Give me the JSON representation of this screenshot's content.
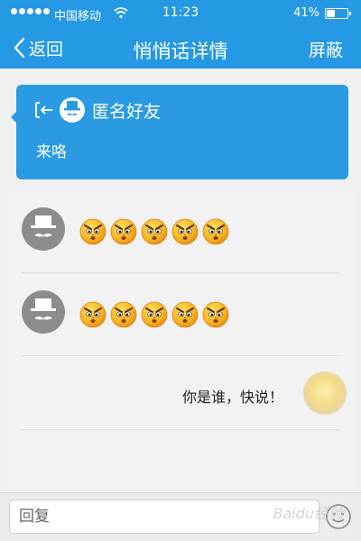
{
  "status_bar": {
    "carrier": "中国移动",
    "time": "11:23",
    "battery_percent": "41%",
    "battery_level": 0.41
  },
  "nav": {
    "back_label": "返回",
    "title": "悄悄话详情",
    "block_label": "屏蔽"
  },
  "message": {
    "sender": "匿名好友",
    "content": "来咯"
  },
  "replies": [
    {
      "from": "other",
      "emojis": [
        "angry-face",
        "angry-face",
        "angry-face",
        "angry-face",
        "angry-face"
      ]
    },
    {
      "from": "other",
      "emojis": [
        "angry-face",
        "angry-face",
        "angry-face",
        "angry-face",
        "angry-face"
      ]
    },
    {
      "from": "me",
      "text": "你是谁，快说！"
    }
  ],
  "input": {
    "placeholder": "回复"
  },
  "watermark": "Baidu经验",
  "colors": {
    "accent": "#2599e3",
    "card": "#2a9be2"
  },
  "icons": {
    "back": "chevron-left-icon",
    "exit": "exit-arrow-icon",
    "anonymous_avatar": "top-hat-mustache-icon",
    "emoji": "angry-face-icon",
    "emoji_button": "smiley-icon"
  }
}
